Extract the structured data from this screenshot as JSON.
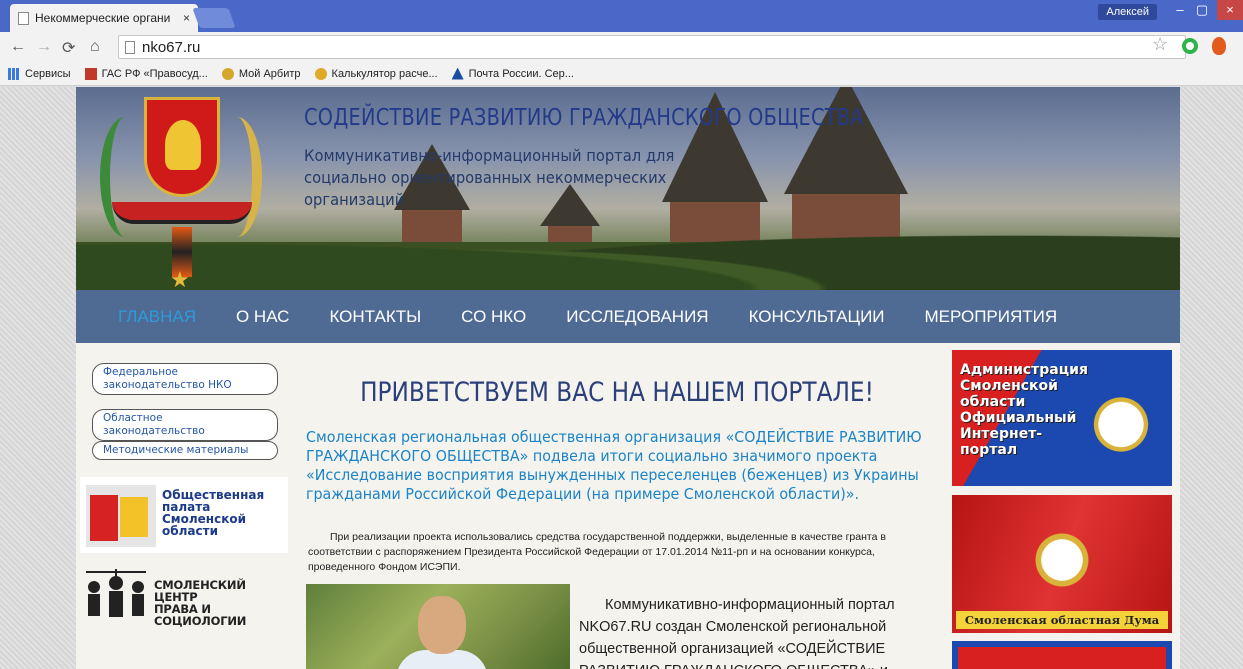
{
  "browser": {
    "tab_title": "Некоммерческие органи",
    "tab_close": "×",
    "user_name": "Алексей",
    "url": "nko67.ru",
    "win_min": "–",
    "win_max": "▢",
    "win_close": "×"
  },
  "bookmarks": {
    "apps_label": "Сервисы",
    "items": [
      {
        "label": "ГАС РФ «Правосуд...",
        "icon": "gas-rf-icon",
        "color": "#c0392b"
      },
      {
        "label": "Мой Арбитр",
        "icon": "arbitr-icon",
        "color": "#d4a72c"
      },
      {
        "label": "Калькулятор расче...",
        "icon": "calculator-icon",
        "color": "#e0a928"
      },
      {
        "label": "Почта России. Сер...",
        "icon": "post-icon",
        "color": "#1a4fa0"
      }
    ]
  },
  "header": {
    "title": "СОДЕЙСТВИЕ РАЗВИТИЮ ГРАЖДАНСКОГО ОБЩЕСТВА",
    "subtitle": "Коммуникативно-информационный портал для социально ориентированных некоммерческих организаций"
  },
  "menu": {
    "items": [
      {
        "label": "ГЛАВНАЯ",
        "active": true
      },
      {
        "label": "О НАС"
      },
      {
        "label": "КОНТАКТЫ"
      },
      {
        "label": "СО НКО"
      },
      {
        "label": "ИССЛЕДОВАНИЯ"
      },
      {
        "label": "КОНСУЛЬТАЦИИ"
      },
      {
        "label": "МЕРОПРИЯТИЯ"
      }
    ]
  },
  "sidebar": {
    "links": [
      "Федеральное законодательство НКО",
      "Областное законодательство",
      "Методические материалы"
    ],
    "chamber_text": "Общественная палата Смоленской области",
    "chamber_lines": [
      "Общественная",
      "палата",
      "Смоленской области"
    ],
    "law_center_lines": [
      "СМОЛЕНСКИЙ ЦЕНТР",
      "ПРАВА И СОЦИОЛОГИИ"
    ]
  },
  "main": {
    "welcome": "ПРИВЕТСТВУЕМ ВАС НА НАШЕМ ПОРТАЛЕ!",
    "lead": "Смоленская региональная общественная организация «СОДЕЙСТВИЕ РАЗВИТИЮ ГРАЖДАНСКОГО ОБЩЕСТВА» подвела итоги социально значимого проекта «Исследование восприятия вынужденных переселенцев (беженцев) из Украины гражданами Российской Федерации (на примере Смоленской области)».",
    "body": "При реализации проекта использовались средства государственной поддержки, выделенные в качестве гранта в соответствии с распоряжением Президента Российской Федерации от 17.01.2014 №11-рп и на основании конкурса, проведенного Фондом ИСЭПИ.",
    "intro": "Коммуникативно-информационный портал NKO67.RU создан Смоленской региональной общественной организацией «СОДЕЙСТВИЕ РАЗВИТИЮ ГРАЖДАНСКОГО ОБЩЕСТВА» и"
  },
  "banners": {
    "admin_lines": [
      "Администрация",
      "Смоленской",
      "области",
      "Официальный",
      "Интернет-",
      "портал"
    ],
    "duma_caption": "Смоленская областная Дума"
  }
}
